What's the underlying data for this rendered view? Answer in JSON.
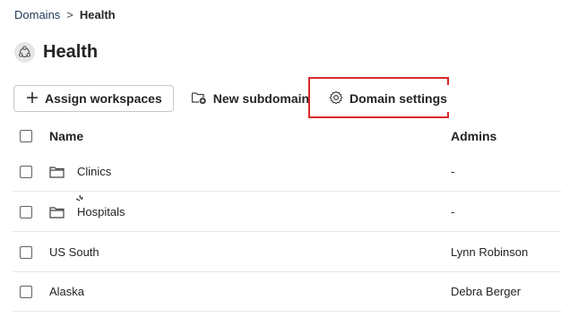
{
  "breadcrumb": {
    "parent": "Domains",
    "separator": ">",
    "current": "Health"
  },
  "page": {
    "title": "Health",
    "icon": "domain-icon"
  },
  "toolbar": {
    "assign_label": "Assign workspaces",
    "new_subdomain_label": "New subdomain",
    "settings_label": "Domain settings",
    "highlight_color": "#d92a2a"
  },
  "table": {
    "columns": {
      "name": "Name",
      "admins": "Admins"
    },
    "rows": [
      {
        "name": "Clinics",
        "admins": "-",
        "folder": true
      },
      {
        "name": "Hospitals",
        "admins": "-",
        "folder": true
      },
      {
        "name": "US South",
        "admins": "Lynn Robinson",
        "folder": false
      },
      {
        "name": "Alaska",
        "admins": "Debra Berger",
        "folder": false
      }
    ]
  }
}
